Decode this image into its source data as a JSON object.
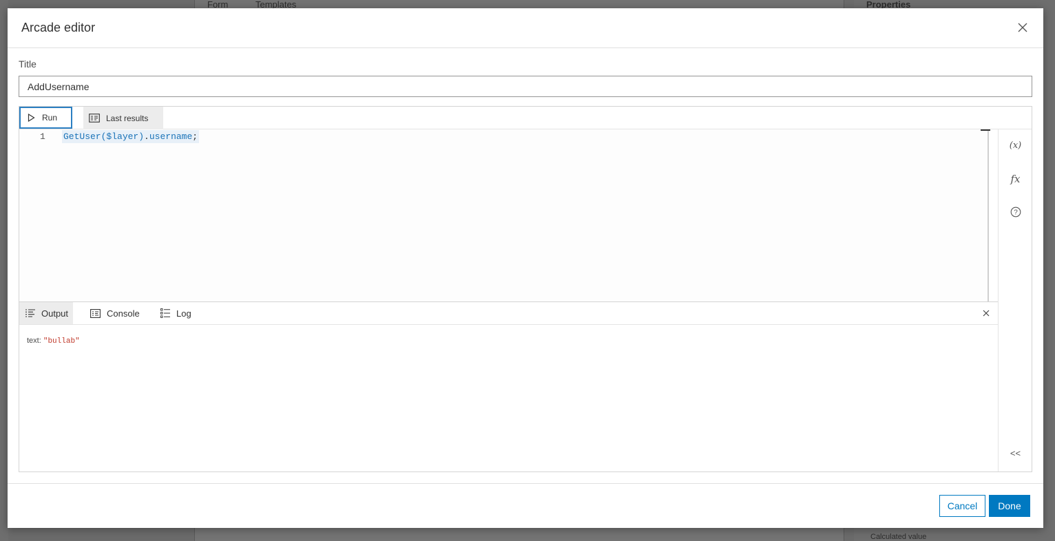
{
  "background": {
    "tabs": [
      "Form",
      "Templates"
    ],
    "right_title": "Properties",
    "right_footer": "Calculated value"
  },
  "modal": {
    "title": "Arcade editor",
    "title_label": "Title",
    "title_value": "AddUsername"
  },
  "toolbar": {
    "run_label": "Run",
    "last_results_label": "Last results"
  },
  "editor": {
    "line_number": "1",
    "code": {
      "fn": "GetUser",
      "open": "(",
      "arg": "$layer",
      "close": ")",
      "dot": ".",
      "prop": "username",
      "semi": ";"
    }
  },
  "side_rail": {
    "variables_icon": "(x)",
    "functions_icon": "fx",
    "help_icon": "?",
    "collapse_icon": "<<"
  },
  "output": {
    "tabs": {
      "output": "Output",
      "console": "Console",
      "log": "Log"
    },
    "result_key": "text:",
    "result_value": "\"bullab\""
  },
  "footer": {
    "cancel_label": "Cancel",
    "done_label": "Done"
  },
  "colors": {
    "accent": "#0079c1",
    "string": "#c0392b",
    "code": "#1a73b8"
  }
}
